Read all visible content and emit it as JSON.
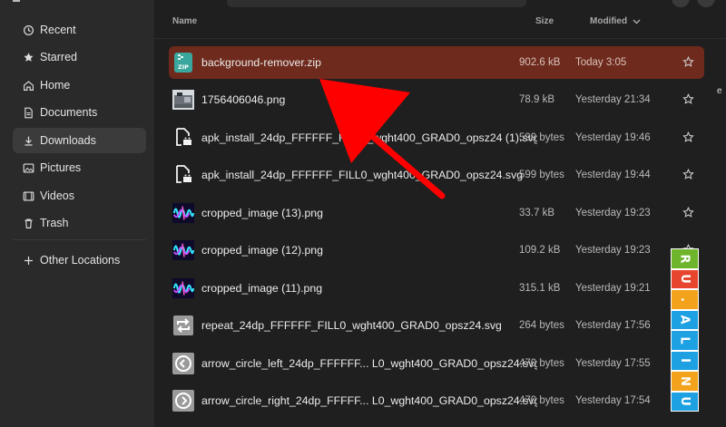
{
  "colors": {
    "selected_row": "#6e2a1c",
    "annotation_arrow": "#ff0000",
    "sidebar_bg": "#2a2a2a",
    "main_bg": "#1f1f1f"
  },
  "sidebar": {
    "items": [
      {
        "label": "Recent",
        "icon": "clock-icon"
      },
      {
        "label": "Starred",
        "icon": "star-icon"
      },
      {
        "label": "Home",
        "icon": "home-icon"
      },
      {
        "label": "Documents",
        "icon": "document-icon"
      },
      {
        "label": "Downloads",
        "icon": "download-icon",
        "active": true
      },
      {
        "label": "Pictures",
        "icon": "picture-icon"
      },
      {
        "label": "Videos",
        "icon": "video-icon"
      },
      {
        "label": "Trash",
        "icon": "trash-icon"
      },
      {
        "label": "Other Locations",
        "icon": "plus-icon"
      }
    ]
  },
  "columns": {
    "name": "Name",
    "size": "Size",
    "modified": "Modified"
  },
  "files": [
    {
      "name": "background-remover.zip",
      "size": "902.6 kB",
      "modified": "Today 3:05",
      "icon": "zip-icon",
      "selected": true
    },
    {
      "name": "1756406046.png",
      "size": "78.9 kB",
      "modified": "Yesterday 21:34",
      "icon": "image-thumb-icon"
    },
    {
      "name": "apk_install_24dp_FFFFFF_FILL0_wght400_GRAD0_opsz24 (1).svg",
      "size": "599 bytes",
      "modified": "Yesterday 19:46",
      "icon": "apk-install-icon"
    },
    {
      "name": "apk_install_24dp_FFFFFF_FILL0_wght400_GRAD0_opsz24.svg",
      "size": "599 bytes",
      "modified": "Yesterday 19:44",
      "icon": "apk-install-icon"
    },
    {
      "name": "cropped_image (13).png",
      "size": "33.7 kB",
      "modified": "Yesterday 19:23",
      "icon": "waveform-thumb-icon"
    },
    {
      "name": "cropped_image (12).png",
      "size": "109.2 kB",
      "modified": "Yesterday 19:23",
      "icon": "waveform-thumb-icon"
    },
    {
      "name": "cropped_image (11).png",
      "size": "315.1 kB",
      "modified": "Yesterday 19:21",
      "icon": "waveform-thumb-icon"
    },
    {
      "name": "repeat_24dp_FFFFFF_FILL0_wght400_GRAD0_opsz24.svg",
      "size": "264 bytes",
      "modified": "Yesterday 17:56",
      "icon": "repeat-icon"
    },
    {
      "name": "arrow_circle_left_24dp_FFFFFF... L0_wght400_GRAD0_opsz24.svg",
      "size": "470 bytes",
      "modified": "Yesterday 17:55",
      "icon": "arrow-circle-left-icon"
    },
    {
      "name": "arrow_circle_right_24dp_FFFFF... L0_wght400_GRAD0_opsz24.svg",
      "size": "470 bytes",
      "modified": "Yesterday 17:54",
      "icon": "arrow-circle-right-icon"
    }
  ],
  "watermark": {
    "letters": [
      "R",
      "U",
      ".",
      "A",
      "L",
      "I",
      "N",
      "U"
    ],
    "colors": [
      "#6fb52c",
      "#e8452e",
      "#f2a31b",
      "#1da1e2",
      "#1da1e2",
      "#1da1e2",
      "#f2a31b",
      "#1da1e2"
    ]
  }
}
